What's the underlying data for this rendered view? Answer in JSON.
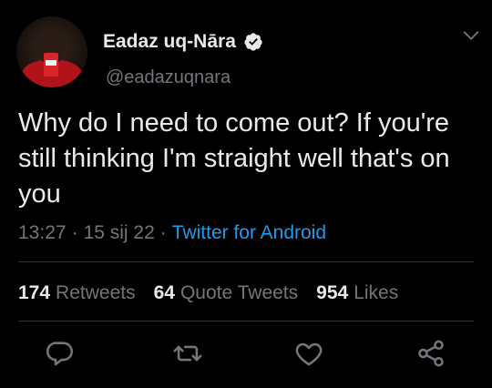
{
  "author": {
    "display_name": "Eadaz uq-Nāra",
    "handle": "@eadazuqnara",
    "verified": true
  },
  "tweet": {
    "text": "Why do I need to come out? If you're still thinking I'm straight well that's on you",
    "time": "13:27",
    "date": "15 sij 22",
    "source": "Twitter for Android"
  },
  "stats": {
    "retweets_count": "174",
    "retweets_label": "Retweets",
    "quotes_count": "64",
    "quotes_label": "Quote Tweets",
    "likes_count": "954",
    "likes_label": "Likes"
  },
  "icons": {
    "verified": "verified-badge-icon",
    "more": "chevron-down-icon",
    "reply": "reply-icon",
    "retweet": "retweet-icon",
    "like": "heart-icon",
    "share": "share-icon"
  },
  "colors": {
    "background": "#000000",
    "text": "#e7e9ea",
    "muted": "#71767b",
    "link": "#1d9bf0",
    "divider": "#2f3336"
  }
}
